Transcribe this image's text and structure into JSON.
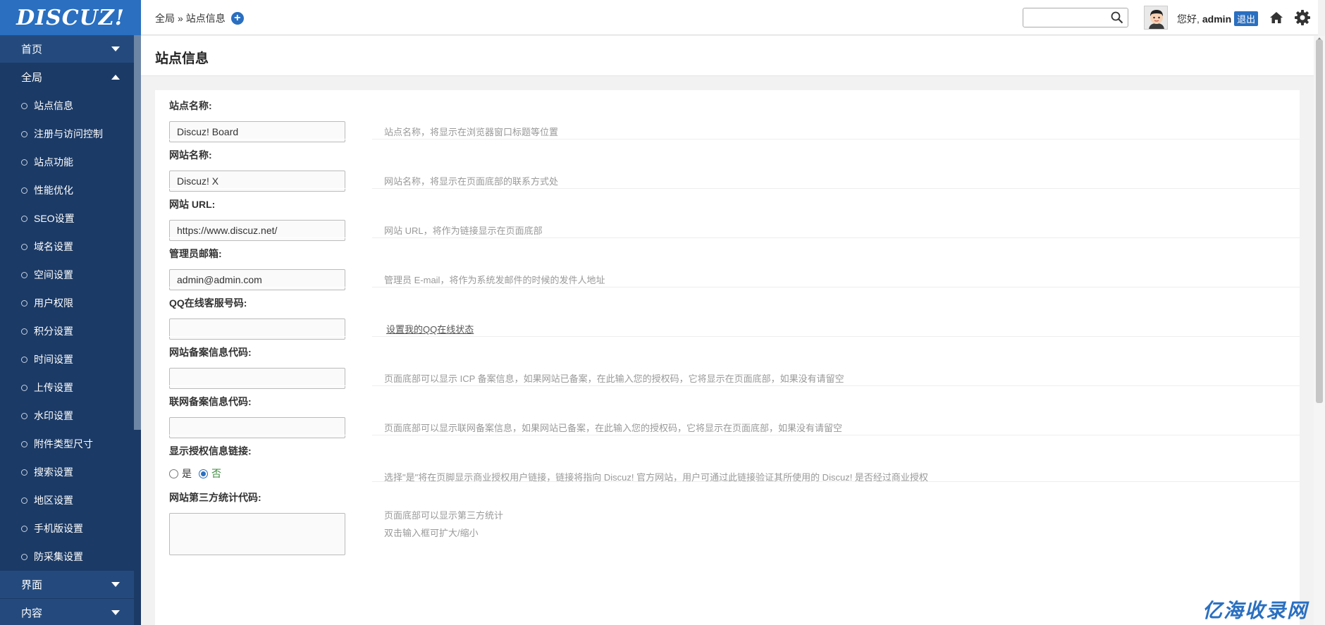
{
  "app": {
    "logo": "DISCUZ!"
  },
  "sidebar": {
    "sections_top": [
      {
        "label": "首页",
        "state": "collapsed"
      },
      {
        "label": "全局",
        "state": "expanded"
      }
    ],
    "items": [
      {
        "label": "站点信息"
      },
      {
        "label": "注册与访问控制"
      },
      {
        "label": "站点功能"
      },
      {
        "label": "性能优化"
      },
      {
        "label": "SEO设置"
      },
      {
        "label": "域名设置"
      },
      {
        "label": "空间设置"
      },
      {
        "label": "用户权限"
      },
      {
        "label": "积分设置"
      },
      {
        "label": "时间设置"
      },
      {
        "label": "上传设置"
      },
      {
        "label": "水印设置"
      },
      {
        "label": "附件类型尺寸"
      },
      {
        "label": "搜索设置"
      },
      {
        "label": "地区设置"
      },
      {
        "label": "手机版设置"
      },
      {
        "label": "防采集设置"
      }
    ],
    "sections_bottom": [
      {
        "label": "界面"
      },
      {
        "label": "内容"
      }
    ]
  },
  "header": {
    "breadcrumb": {
      "root": "全局",
      "sep": "»",
      "current": "站点信息",
      "add_icon": "+"
    },
    "search": {
      "value": "",
      "placeholder": ""
    },
    "greeting": "您好,",
    "username": "admin",
    "logout": "退出"
  },
  "page": {
    "title": "站点信息"
  },
  "form": {
    "site_name": {
      "label": "站点名称:",
      "value": "Discuz! Board",
      "tip": "站点名称，将显示在浏览器窗口标题等位置"
    },
    "web_name": {
      "label": "网站名称:",
      "value": "Discuz! X",
      "tip": "网站名称，将显示在页面底部的联系方式处"
    },
    "site_url": {
      "label": "网站 URL:",
      "value": "https://www.discuz.net/",
      "tip": "网站 URL，将作为链接显示在页面底部"
    },
    "admin_email": {
      "label": "管理员邮箱:",
      "value": "admin@admin.com",
      "tip": "管理员 E-mail，将作为系统发邮件的时候的发件人地址"
    },
    "qq": {
      "label": "QQ在线客服号码:",
      "value": "",
      "link": "设置我的QQ在线状态"
    },
    "icp": {
      "label": "网站备案信息代码:",
      "value": "",
      "tip": "页面底部可以显示 ICP 备案信息，如果网站已备案，在此输入您的授权码，它将显示在页面底部，如果没有请留空"
    },
    "mps": {
      "label": "联网备案信息代码:",
      "value": "",
      "tip": "页面底部可以显示联网备案信息，如果网站已备案，在此输入您的授权码，它将显示在页面底部，如果没有请留空"
    },
    "license": {
      "label": "显示授权信息链接:",
      "yes": "是",
      "no": "否",
      "selected": "否",
      "tip": "选择\"是\"将在页脚显示商业授权用户链接，链接将指向 Discuz! 官方网站，用户可通过此链接验证其所使用的 Discuz! 是否经过商业授权"
    },
    "stats": {
      "label": "网站第三方统计代码:",
      "tip1": "页面底部可以显示第三方统计",
      "tip2": "双击输入框可扩大/缩小"
    }
  },
  "watermark": "亿海收录网",
  "colors": {
    "sidebar": "#1b3a66",
    "accent": "#2a6fc0"
  }
}
